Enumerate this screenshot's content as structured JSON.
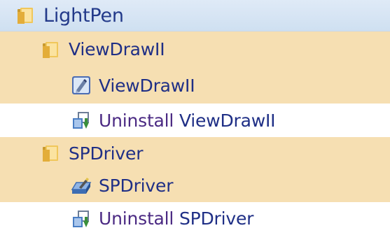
{
  "tree": {
    "root": {
      "label": "LightPen",
      "icon": "folder-icon"
    },
    "items": [
      {
        "label": "ViewDrawII",
        "icon": "folder-icon",
        "type": "folder"
      },
      {
        "label": "ViewDrawII",
        "icon": "viewdraw-app-icon",
        "type": "shortcut"
      },
      {
        "uninstall_word": "Uninstall",
        "label": "ViewDrawII",
        "icon": "uninstall-icon",
        "type": "shortcut"
      },
      {
        "label": "SPDriver",
        "icon": "folder-icon",
        "type": "folder"
      },
      {
        "label": "SPDriver",
        "icon": "spdriver-app-icon",
        "type": "shortcut"
      },
      {
        "uninstall_word": "Uninstall",
        "label": "SPDriver",
        "icon": "uninstall-icon",
        "type": "shortcut"
      }
    ]
  },
  "colors": {
    "root_background": "#d6e5f4",
    "selected_background": "#f6dfb2",
    "text": "#1f2f86",
    "uninstall_text": "#4b2a83"
  }
}
